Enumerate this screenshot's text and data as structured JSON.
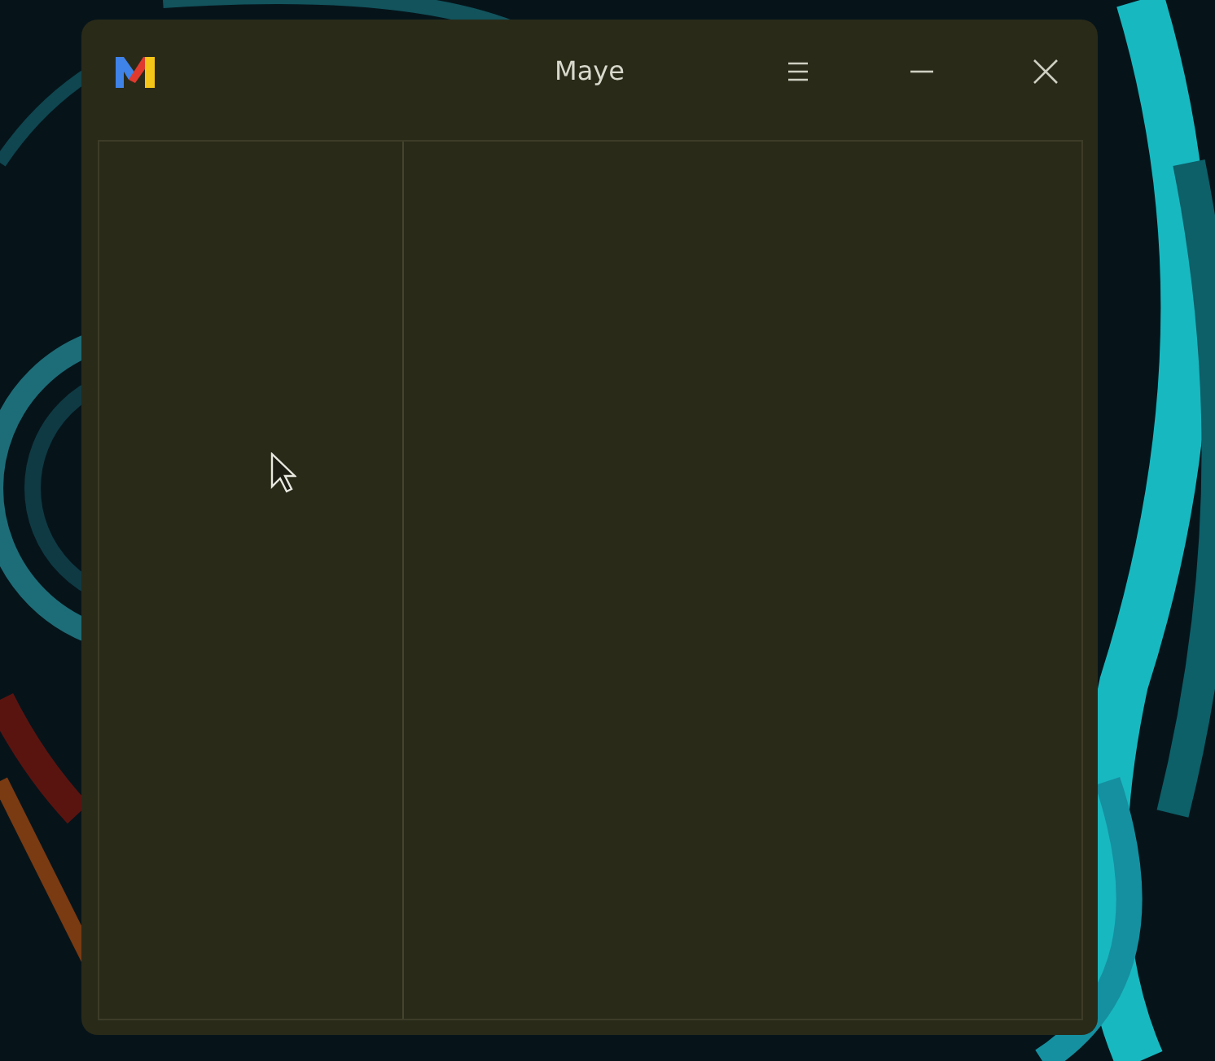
{
  "window": {
    "title": "Maye"
  }
}
